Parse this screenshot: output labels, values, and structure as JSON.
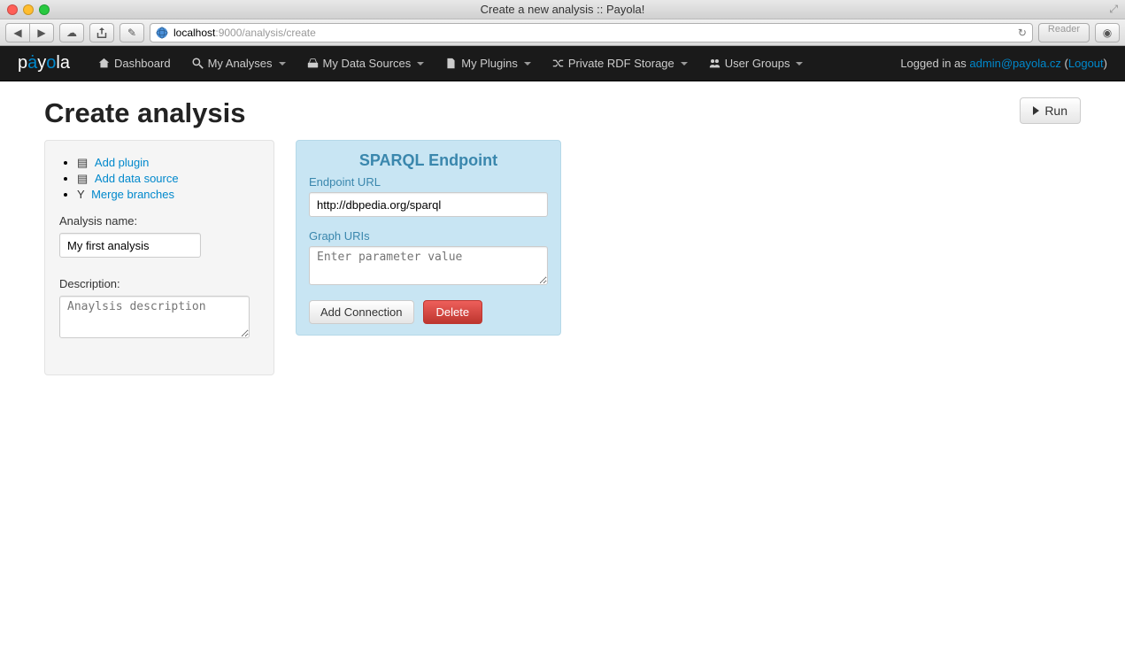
{
  "window": {
    "title": "Create a new analysis :: Payola!"
  },
  "urlbar": {
    "host": "localhost",
    "port": ":9000",
    "path": "/analysis/create",
    "reader": "Reader"
  },
  "nav": {
    "logo": "payola",
    "items": [
      {
        "label": "Dashboard",
        "dropdown": false
      },
      {
        "label": "My Analyses",
        "dropdown": true
      },
      {
        "label": "My Data Sources",
        "dropdown": true
      },
      {
        "label": "My Plugins",
        "dropdown": true
      },
      {
        "label": "Private RDF Storage",
        "dropdown": true
      },
      {
        "label": "User Groups",
        "dropdown": true
      }
    ],
    "right": {
      "prefix": "Logged in as ",
      "email": "admin@payola.cz",
      "logout": "Logout"
    }
  },
  "page": {
    "heading": "Create analysis",
    "run_label": "Run"
  },
  "sidebar": {
    "actions": [
      {
        "label": "Add plugin"
      },
      {
        "label": "Add data source"
      },
      {
        "label": "Merge branches"
      }
    ],
    "name_label": "Analysis name:",
    "name_value": "My first analysis",
    "desc_label": "Description:",
    "desc_placeholder": "Anaylsis description"
  },
  "plugin": {
    "title": "SPARQL Endpoint",
    "endpoint_label": "Endpoint URL",
    "endpoint_value": "http://dbpedia.org/sparql",
    "graphs_label": "Graph URIs",
    "graphs_placeholder": "Enter parameter value",
    "add_connection": "Add Connection",
    "delete": "Delete"
  }
}
